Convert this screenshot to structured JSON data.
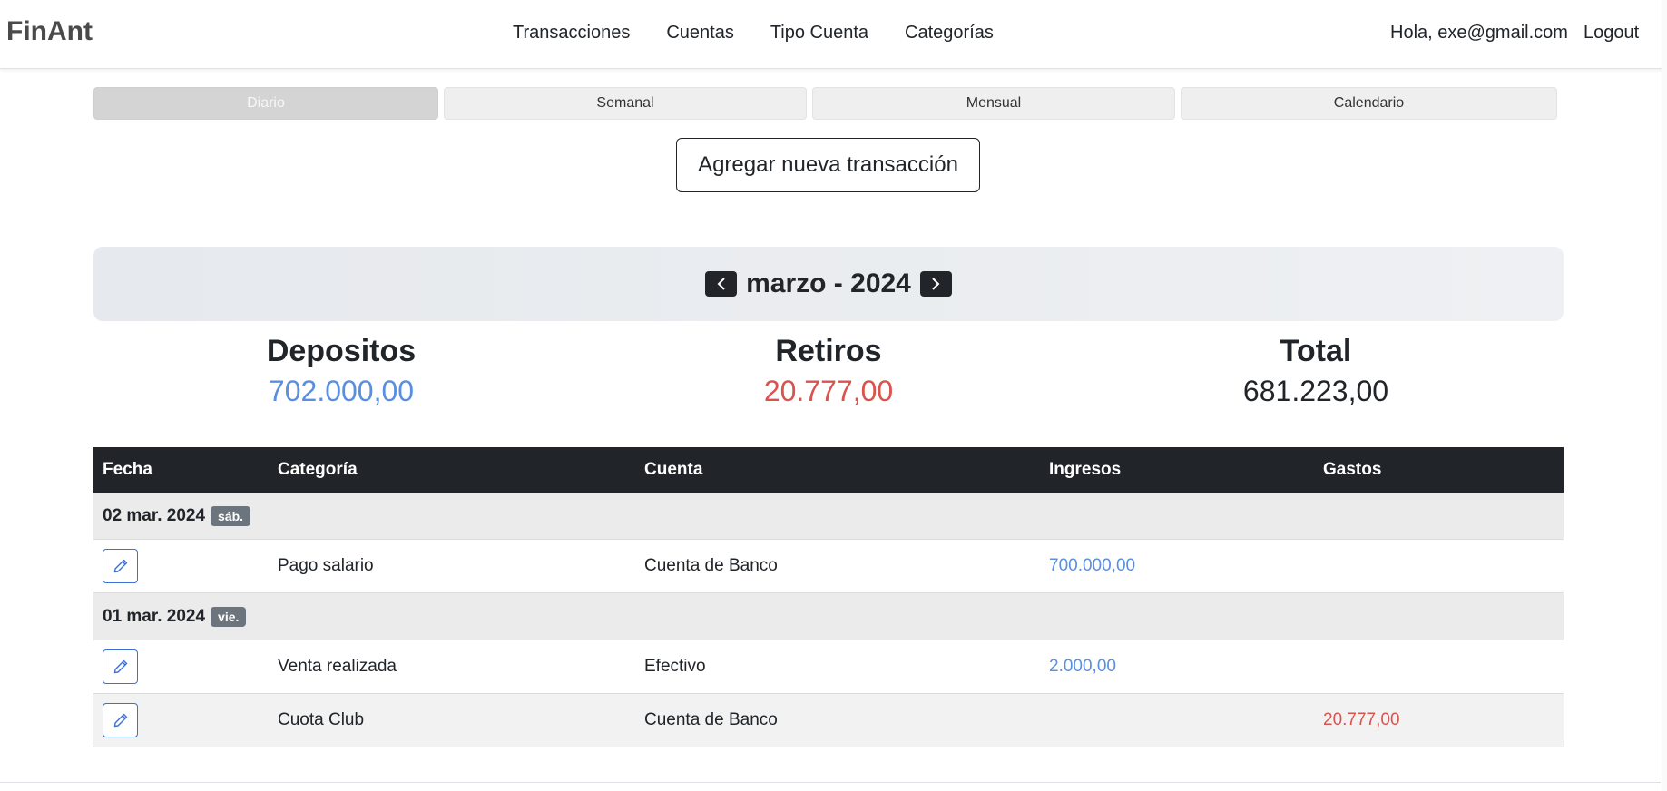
{
  "navbar": {
    "brand": "FinAnt",
    "links": [
      "Transacciones",
      "Cuentas",
      "Tipo Cuenta",
      "Categorías"
    ],
    "greeting": "Hola, exe@gmail.com",
    "logout": "Logout"
  },
  "tabs": [
    {
      "label": "Diario",
      "active": true
    },
    {
      "label": "Semanal",
      "active": false
    },
    {
      "label": "Mensual",
      "active": false
    },
    {
      "label": "Calendario",
      "active": false
    }
  ],
  "add_button": "Agregar nueva transacción",
  "period": {
    "label": "marzo - 2024",
    "prev_icon": "chevron-left-icon",
    "next_icon": "chevron-right-icon"
  },
  "summary": {
    "deposits_label": "Depositos",
    "deposits_value": "702.000,00",
    "withdrawals_label": "Retiros",
    "withdrawals_value": "20.777,00",
    "total_label": "Total",
    "total_value": "681.223,00"
  },
  "colors": {
    "income": "#5a8fe0",
    "expense": "#d9534f",
    "header_bg": "#212529"
  },
  "table": {
    "headers": [
      "Fecha",
      "Categoría",
      "Cuenta",
      "Ingresos",
      "Gastos"
    ],
    "groups": [
      {
        "date": "02 mar. 2024",
        "weekday": "sáb.",
        "rows": [
          {
            "category": "Pago salario",
            "account": "Cuenta de Banco",
            "income": "700.000,00",
            "expense": ""
          }
        ]
      },
      {
        "date": "01 mar. 2024",
        "weekday": "vie.",
        "rows": [
          {
            "category": "Venta realizada",
            "account": "Efectivo",
            "income": "2.000,00",
            "expense": ""
          },
          {
            "category": "Cuota Club",
            "account": "Cuenta de Banco",
            "income": "",
            "expense": "20.777,00"
          }
        ]
      }
    ]
  }
}
